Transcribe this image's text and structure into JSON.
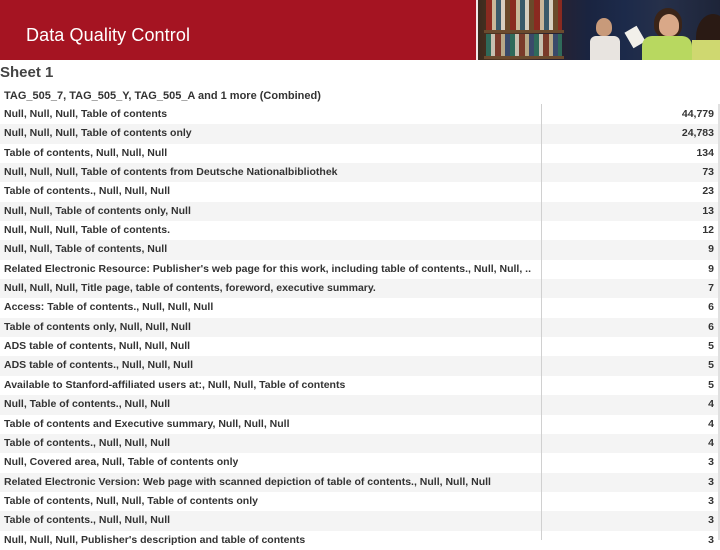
{
  "banner": {
    "title": "Data Quality Control",
    "brand_color": "#a51422",
    "photo_description": "library-study-scene"
  },
  "sheet": {
    "title": "Sheet 1",
    "column_header": "TAG_505_7, TAG_505_Y, TAG_505_A and 1 more (Combined)"
  },
  "rows": [
    {
      "label": "Null, Null, Null, Table of contents",
      "count": "44,779"
    },
    {
      "label": "Null, Null, Null, Table of contents only",
      "count": "24,783"
    },
    {
      "label": "Table of contents, Null, Null, Null",
      "count": "134"
    },
    {
      "label": "Null, Null, Null, Table of contents from Deutsche Nationalbibliothek",
      "count": "73"
    },
    {
      "label": "Table of contents., Null, Null, Null",
      "count": "23"
    },
    {
      "label": "Null, Null, Table of contents only, Null",
      "count": "13"
    },
    {
      "label": "Null, Null, Null, Table of contents.",
      "count": "12"
    },
    {
      "label": "Null, Null, Table of contents, Null",
      "count": "9"
    },
    {
      "label": "Related Electronic Resource: Publisher's web page for this work, including table of contents., Null, Null, ..",
      "count": "9"
    },
    {
      "label": "Null, Null, Null, Title page, table of contents, foreword, executive summary.",
      "count": "7"
    },
    {
      "label": "Access: Table of contents., Null, Null, Null",
      "count": "6"
    },
    {
      "label": "Table of contents only, Null, Null, Null",
      "count": "6"
    },
    {
      "label": "ADS table of contents, Null, Null, Null",
      "count": "5"
    },
    {
      "label": "ADS table of contents., Null, Null, Null",
      "count": "5"
    },
    {
      "label": "Available to Stanford-affiliated users at:, Null, Null, Table of contents",
      "count": "5"
    },
    {
      "label": "Null, Table of contents., Null, Null",
      "count": "4"
    },
    {
      "label": "Table of contents and Executive summary, Null, Null, Null",
      "count": "4"
    },
    {
      "label": "Table of contents., Null, Null, Null",
      "count": "4"
    },
    {
      "label": "Null, Covered area, Null, Table of contents only",
      "count": "3"
    },
    {
      "label": "Related Electronic Version: Web page with scanned depiction of table of contents., Null, Null, Null",
      "count": "3"
    },
    {
      "label": "Table of contents, Null, Null, Table of contents only",
      "count": "3"
    },
    {
      "label": "Table of contents., Null, Null, Null",
      "count": "3"
    },
    {
      "label": "Null, Null, Null, Publisher's description and table of contents",
      "count": "3"
    }
  ]
}
